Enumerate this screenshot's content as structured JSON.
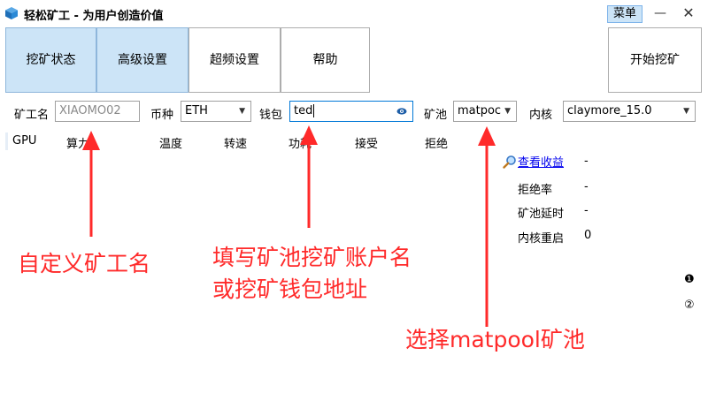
{
  "window": {
    "title": "轻松矿工 - 为用户创造价值",
    "menu_label": "菜单",
    "minimize_glyph": "—",
    "close_glyph": "✕"
  },
  "tabs": [
    {
      "label": "挖矿状态",
      "active": true
    },
    {
      "label": "高级设置",
      "active": true
    },
    {
      "label": "超频设置",
      "active": false
    },
    {
      "label": "帮助",
      "active": false
    }
  ],
  "start_button_label": "开始挖矿",
  "form": {
    "miner_name_label": "矿工名",
    "miner_name_value": "XIAOMO02",
    "coin_label": "币种",
    "coin_value": "ETH",
    "wallet_label": "钱包",
    "wallet_value": "ted",
    "pool_label": "矿池",
    "pool_value": "matpoc",
    "kernel_label": "内核",
    "kernel_value": "claymore_15.0"
  },
  "table_headers": [
    "GPU",
    "算力",
    "温度",
    "转速",
    "功耗",
    "接受",
    "拒绝"
  ],
  "stats": {
    "view_earnings": "查看收益",
    "view_earnings_value": "-",
    "reject_rate_label": "拒绝率",
    "reject_rate_value": "-",
    "pool_latency_label": "矿池延时",
    "pool_latency_value": "-",
    "kernel_restart_label": "内核重启",
    "kernel_restart_value": "0"
  },
  "annotations": {
    "custom_miner": "自定义矿工名",
    "wallet_line1": "填写矿池挖矿账户名",
    "wallet_line2": "或挖矿钱包地址",
    "pool_select": "选择matpool矿池"
  },
  "side_icons": [
    "❶",
    "②"
  ],
  "colors": {
    "accent_blue": "#cce4f7",
    "annotation_red": "#ff2a2a",
    "link_blue": "#0000ee"
  }
}
